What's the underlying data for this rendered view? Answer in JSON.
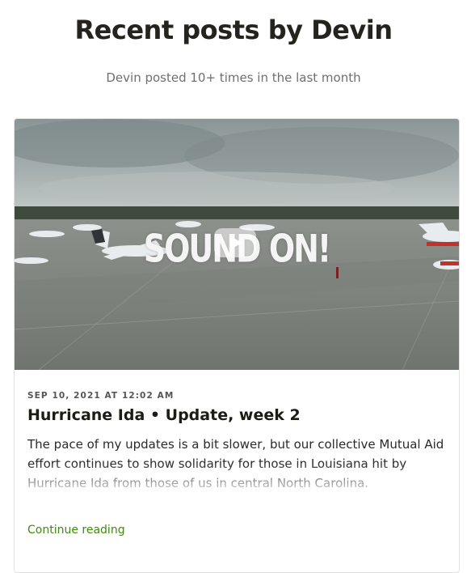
{
  "header": {
    "title": "Recent posts by Devin",
    "subtitle": "Devin posted 10+ times in the last month"
  },
  "post": {
    "video_overlay_text": "SOUND ON!",
    "date": "SEP 10, 2021 AT 12:02 AM",
    "title": "Hurricane Ida • Update, week 2",
    "excerpt": "The pace of my updates is a bit slower, but our collective Mutual Aid effort continues to show solidarity for those in Louisiana hit by Hurricane Ida from those of us in central North Carolina.",
    "continue_label": "Continue reading"
  },
  "colors": {
    "link": "#3f8a10",
    "title": "#25231d"
  }
}
